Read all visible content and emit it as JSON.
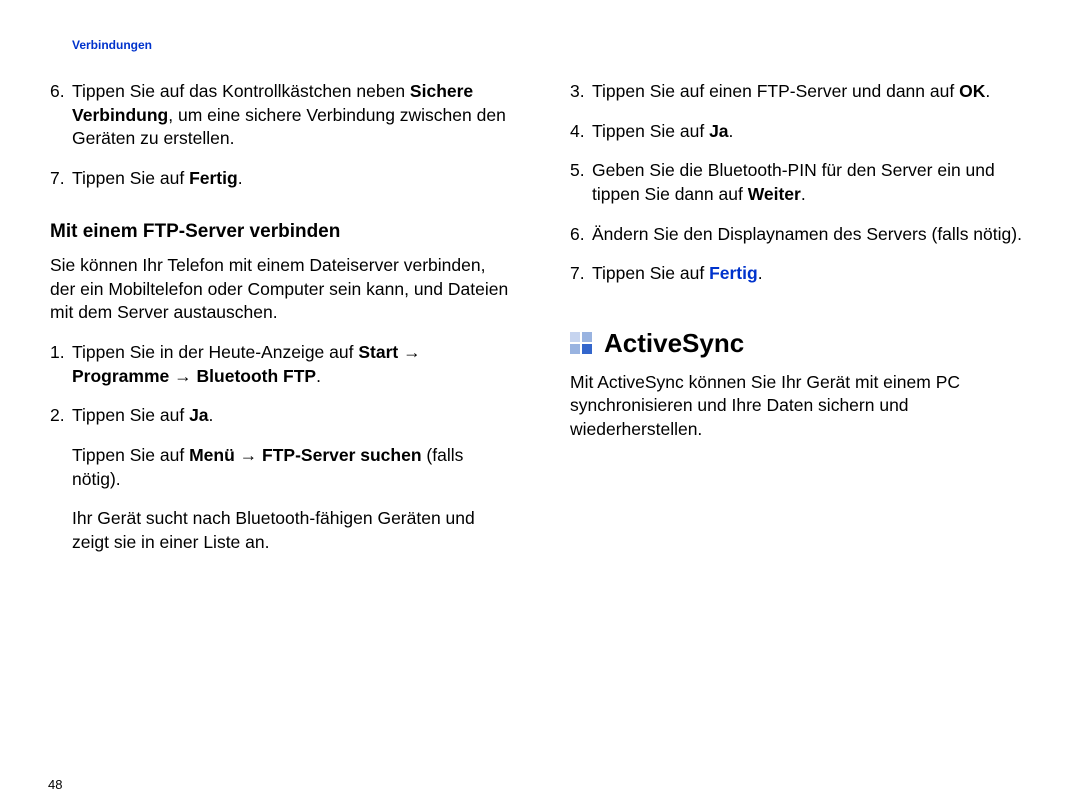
{
  "running_head": "Verbindungen",
  "page_number": "48",
  "left": {
    "item6_pre": "Tippen Sie auf das Kontrollkästchen neben ",
    "item6_bold": "Sichere Verbindung",
    "item6_post": ", um eine sichere Verbindung zwischen den Geräten zu erstellen.",
    "item7_pre": "Tippen Sie auf ",
    "item7_bold": "Fertig",
    "item7_post": ".",
    "subhead": "Mit einem FTP-Server verbinden",
    "intro": "Sie können Ihr Telefon mit einem Dateiserver verbinden, der ein Mobiltelefon oder Computer sein kann, und Dateien mit dem Server austauschen.",
    "l1_pre": "Tippen Sie in der Heute-Anzeige auf ",
    "l1_b1": "Start",
    "l1_b2": "Programme",
    "l1_b3": "Bluetooth FTP",
    "l2_pre": "Tippen Sie auf ",
    "l2_bold": "Ja",
    "l2_post": ".",
    "sub1_pre": "Tippen Sie auf ",
    "sub1_b1": "Menü",
    "sub1_b2": "FTP-Server suchen",
    "sub1_post": " (falls nötig).",
    "sub2": "Ihr Gerät sucht nach Bluetooth-fähigen Geräten und zeigt sie in einer Liste an."
  },
  "right": {
    "r3_pre": "Tippen Sie auf einen FTP-Server und dann auf ",
    "r3_bold": "OK",
    "r4_pre": "Tippen Sie auf ",
    "r4_bold": "Ja",
    "r5_pre": "Geben Sie die Bluetooth-PIN für den Server ein und tippen Sie dann auf ",
    "r5_bold": "Weiter",
    "r6": "Ändern Sie den Displaynamen des Servers (falls nötig).",
    "r7_pre": "Tippen Sie auf ",
    "r7_link": "Fertig",
    "section": "ActiveSync",
    "section_intro": "Mit ActiveSync können Sie Ihr Gerät mit einem PC synchronisieren und Ihre Daten sichern und wiederherstellen."
  }
}
